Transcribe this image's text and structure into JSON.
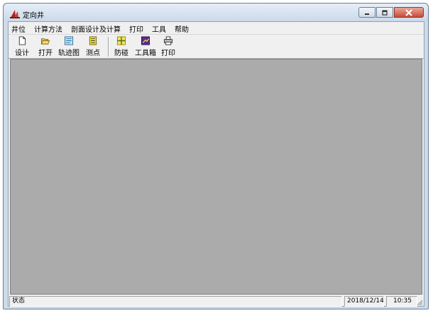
{
  "window": {
    "title": "定向井"
  },
  "menu": [
    "井位",
    "计算方法",
    "剖面设计及计算",
    "打印",
    "工具",
    "帮助"
  ],
  "toolbar": {
    "design": "设计",
    "open": "打开",
    "trajectory": "轨迹图",
    "survey": "测点",
    "anticollision": "防碰",
    "toolbox": "工具箱",
    "print": "打印"
  },
  "status": {
    "text": "状态",
    "date": "2018/12/14",
    "time": "10:35"
  },
  "colors": {
    "workspace": "#ababab",
    "client": "#f0f0f0",
    "close_button": "#c84a35"
  }
}
